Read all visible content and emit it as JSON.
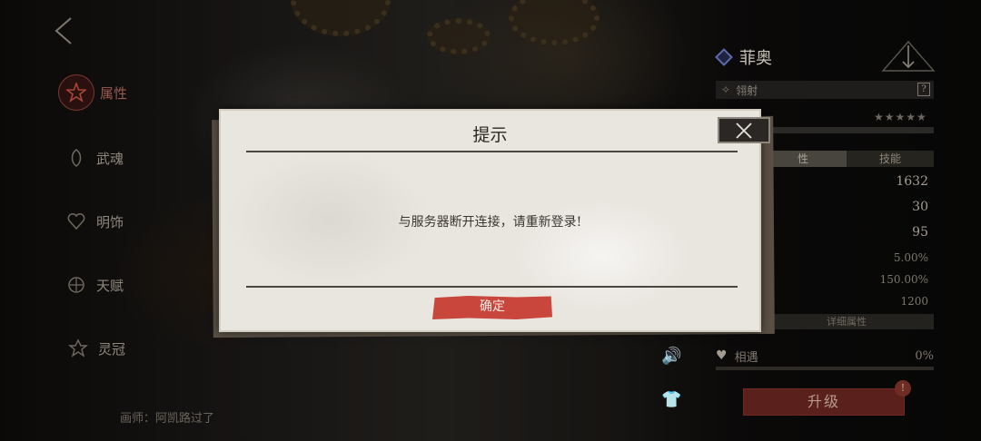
{
  "left_nav": {
    "items": [
      {
        "label": "属性",
        "icon": "star-icon",
        "active": true
      },
      {
        "label": "武魂",
        "icon": "spirit-icon",
        "active": false
      },
      {
        "label": "明饰",
        "icon": "heart-gem-icon",
        "active": false
      },
      {
        "label": "天赋",
        "icon": "talent-icon",
        "active": false
      },
      {
        "label": "灵冠",
        "icon": "crown-icon",
        "active": false
      }
    ],
    "credit": "画师：阿凯路过了"
  },
  "hero": {
    "name": "菲奥",
    "type": "翎射",
    "help": "?",
    "stars": "★★★★★"
  },
  "tabs": {
    "attributes": "性",
    "skills": "技能"
  },
  "stats": [
    "1632",
    "30",
    "95",
    "5.00%",
    "150.00%",
    "1200"
  ],
  "detail_label": "详细属性",
  "affection": {
    "label": "相遇",
    "value": "0%"
  },
  "upgrade": {
    "label": "升级",
    "badge": "!"
  },
  "dialog": {
    "title": "提示",
    "message": "与服务器断开连接，请重新登录!",
    "confirm_label": "确定"
  },
  "colors": {
    "confirm_red": "#c9463d",
    "dialog_paper": "#e9e5df",
    "upgrade_red": "#5a201b"
  }
}
